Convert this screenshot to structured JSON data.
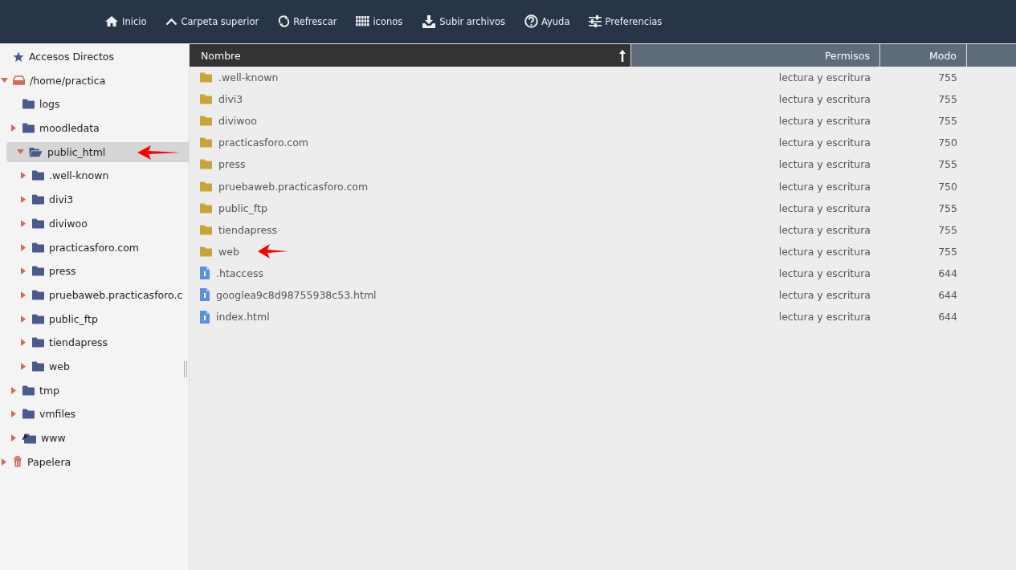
{
  "toolbar": [
    {
      "kind": "home",
      "label": "Inicio"
    },
    {
      "kind": "up",
      "label": "Carpeta superior"
    },
    {
      "kind": "refresh",
      "label": "Refrescar"
    },
    {
      "kind": "grid",
      "label": "iconos"
    },
    {
      "kind": "upload",
      "label": "Subir archivos"
    },
    {
      "kind": "help",
      "label": "Ayuda"
    },
    {
      "kind": "prefs",
      "label": "Preferencias"
    }
  ],
  "sidebar": {
    "items": [
      {
        "kind": "shortcut",
        "label": "Accesos Directos",
        "has_children": false,
        "expanded": false,
        "selected": false,
        "marked": false
      },
      {
        "kind": "drive",
        "label": "/home/practica",
        "has_children": true,
        "expanded": true,
        "selected": false,
        "marked": false,
        "children": [
          {
            "kind": "folder",
            "label": "logs",
            "has_children": false,
            "expanded": false,
            "selected": false,
            "marked": false
          },
          {
            "kind": "folder",
            "label": "moodledata",
            "has_children": true,
            "expanded": false,
            "selected": false,
            "marked": false
          },
          {
            "kind": "folder",
            "label": "public_html",
            "has_children": true,
            "expanded": true,
            "selected": true,
            "marked": true,
            "children": [
              {
                "kind": "folder",
                "label": ".well-known",
                "has_children": true,
                "expanded": false,
                "selected": false,
                "marked": false
              },
              {
                "kind": "folder",
                "label": "divi3",
                "has_children": true,
                "expanded": false,
                "selected": false,
                "marked": false
              },
              {
                "kind": "folder",
                "label": "diviwoo",
                "has_children": true,
                "expanded": false,
                "selected": false,
                "marked": false
              },
              {
                "kind": "folder",
                "label": "practicasforo.com",
                "has_children": true,
                "expanded": false,
                "selected": false,
                "marked": false
              },
              {
                "kind": "folder",
                "label": "press",
                "has_children": true,
                "expanded": false,
                "selected": false,
                "marked": false
              },
              {
                "kind": "folder",
                "label": "pruebaweb.practicasforo.c",
                "has_children": true,
                "expanded": false,
                "selected": false,
                "marked": false
              },
              {
                "kind": "folder",
                "label": "public_ftp",
                "has_children": true,
                "expanded": false,
                "selected": false,
                "marked": false
              },
              {
                "kind": "folder",
                "label": "tiendapress",
                "has_children": true,
                "expanded": false,
                "selected": false,
                "marked": false
              },
              {
                "kind": "folder",
                "label": "web",
                "has_children": true,
                "expanded": false,
                "selected": false,
                "marked": false
              }
            ]
          },
          {
            "kind": "folder",
            "label": "tmp",
            "has_children": true,
            "expanded": false,
            "selected": false,
            "marked": false
          },
          {
            "kind": "folder",
            "label": "vmfiles",
            "has_children": true,
            "expanded": false,
            "selected": false,
            "marked": false
          },
          {
            "kind": "link",
            "label": "www",
            "has_children": true,
            "expanded": false,
            "selected": false,
            "marked": false
          }
        ]
      },
      {
        "kind": "trash",
        "label": "Papelera",
        "has_children": true,
        "expanded": false,
        "selected": false,
        "marked": false
      }
    ]
  },
  "table": {
    "columns": [
      "Nombre",
      "Permisos",
      "Modo"
    ],
    "rows": [
      {
        "kind": "folder",
        "name": ".well-known",
        "permissions": "lectura y escritura",
        "mode": "755",
        "marked": false
      },
      {
        "kind": "folder",
        "name": "divi3",
        "permissions": "lectura y escritura",
        "mode": "755",
        "marked": false
      },
      {
        "kind": "folder",
        "name": "diviwoo",
        "permissions": "lectura y escritura",
        "mode": "755",
        "marked": false
      },
      {
        "kind": "folder",
        "name": "practicasforo.com",
        "permissions": "lectura y escritura",
        "mode": "750",
        "marked": false
      },
      {
        "kind": "folder",
        "name": "press",
        "permissions": "lectura y escritura",
        "mode": "755",
        "marked": false
      },
      {
        "kind": "folder",
        "name": "pruebaweb.practicasforo.com",
        "permissions": "lectura y escritura",
        "mode": "750",
        "marked": false
      },
      {
        "kind": "folder",
        "name": "public_ftp",
        "permissions": "lectura y escritura",
        "mode": "755",
        "marked": false
      },
      {
        "kind": "folder",
        "name": "tiendapress",
        "permissions": "lectura y escritura",
        "mode": "755",
        "marked": false
      },
      {
        "kind": "folder",
        "name": "web",
        "permissions": "lectura y escritura",
        "mode": "755",
        "marked": true
      },
      {
        "kind": "file",
        "name": ".htaccess",
        "permissions": "lectura y escritura",
        "mode": "644",
        "marked": false
      },
      {
        "kind": "file",
        "name": "googlea9c8d98755938c53.html",
        "permissions": "lectura y escritura",
        "mode": "644",
        "marked": false
      },
      {
        "kind": "file",
        "name": "index.html",
        "permissions": "lectura y escritura",
        "mode": "644",
        "marked": false
      }
    ]
  }
}
